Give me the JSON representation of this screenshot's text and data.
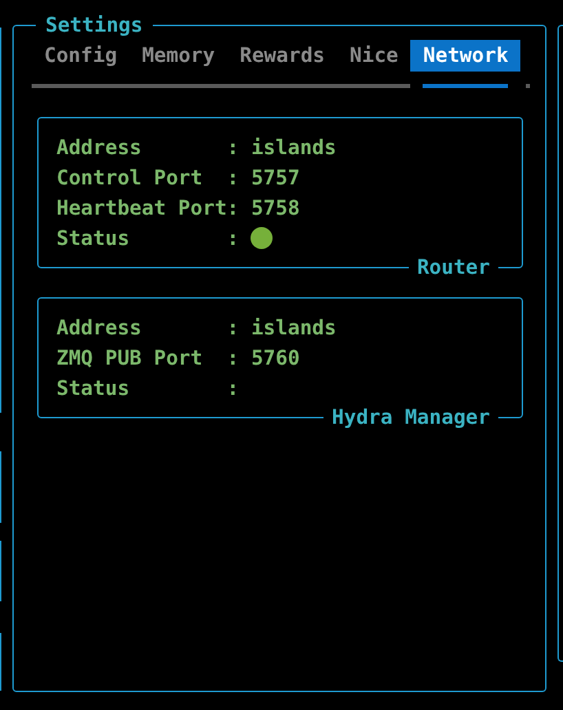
{
  "panel": {
    "title": "Settings"
  },
  "tabs": [
    {
      "label": "Config",
      "selected": false
    },
    {
      "label": "Memory",
      "selected": false
    },
    {
      "label": "Rewards",
      "selected": false
    },
    {
      "label": "Nice",
      "selected": false
    },
    {
      "label": "Network",
      "selected": true
    }
  ],
  "cards": [
    {
      "title": "Router",
      "rows": [
        {
          "kind": "text",
          "label": "Address",
          "separator": ":",
          "value": "islands"
        },
        {
          "kind": "text",
          "label": "Control Port",
          "separator": ":",
          "value": "5757"
        },
        {
          "kind": "text",
          "label": "Heartbeat Port",
          "separator": ":",
          "value": "5758"
        },
        {
          "kind": "status",
          "label": "Status",
          "separator": ":",
          "on": true
        }
      ]
    },
    {
      "title": "Hydra Manager",
      "rows": [
        {
          "kind": "text",
          "label": "Address",
          "separator": ":",
          "value": "islands"
        },
        {
          "kind": "text",
          "label": "ZMQ PUB Port",
          "separator": ":",
          "value": "5760"
        },
        {
          "kind": "status",
          "label": "Status",
          "separator": ":",
          "on": false
        }
      ]
    }
  ]
}
